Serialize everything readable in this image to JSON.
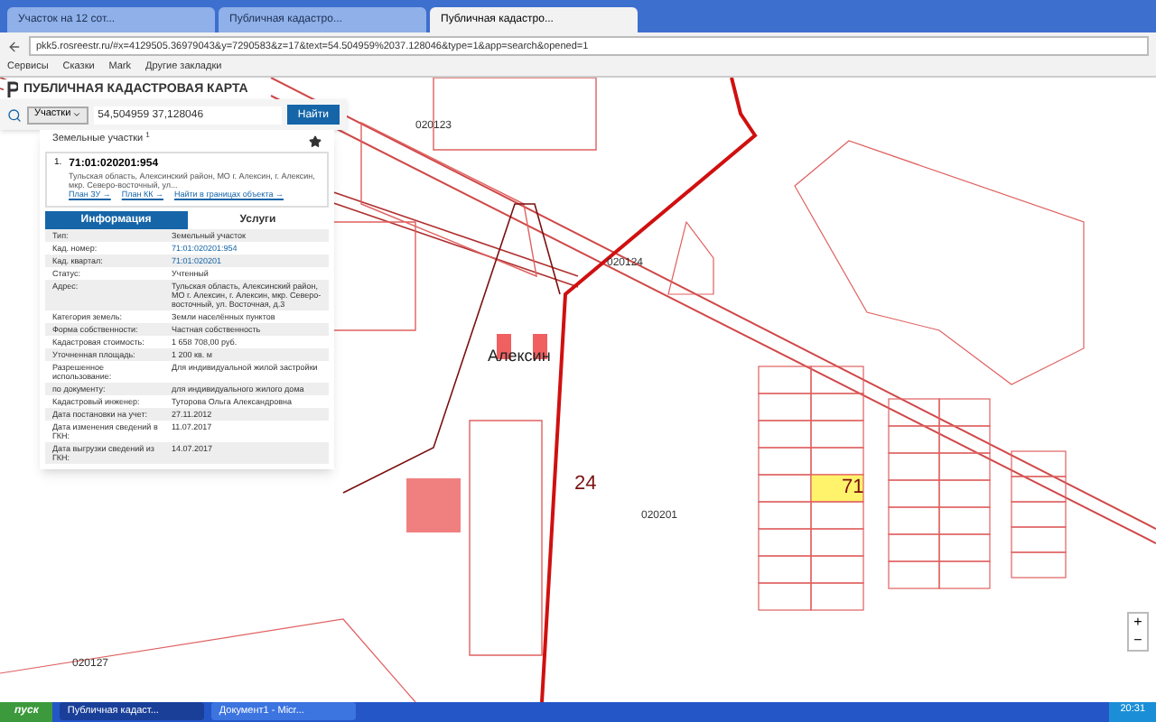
{
  "browser": {
    "tabs": [
      {
        "label": "Участок на 12 сот...",
        "selected": false
      },
      {
        "label": "Публичная кадастро...",
        "selected": false
      },
      {
        "label": "Публичная кадастро...",
        "selected": true
      }
    ],
    "url": "pkk5.rosreestr.ru/#x=4129505.36979043&y=7290583&z=17&text=54.504959%2037.128046&type=1&app=search&opened=1",
    "bookmarks": [
      "Сервисы",
      "Сказки",
      "Mark",
      "Другие закладки"
    ]
  },
  "header": {
    "title": "ПУБЛИЧНАЯ КАДАСТРОВАЯ КАРТА"
  },
  "search": {
    "type": "Участки",
    "value": "54,504959 37,128046",
    "button": "Найти"
  },
  "results": {
    "title": "Земельные участки",
    "count": "1",
    "item": {
      "index": "1.",
      "number": "71:01:020201:954",
      "address": "Тульская область, Алексинский район, МО г. Алексин, г. Алексин, мкр. Северо-восточный, ул...",
      "links": [
        "План ЗУ →",
        "План КК →",
        "Найти в границах объекта →"
      ]
    },
    "tabs": [
      {
        "label": "Информация",
        "selected": true
      },
      {
        "label": "Услуги",
        "selected": false
      }
    ],
    "rows": [
      {
        "label": "Тип:",
        "value": "Земельный участок",
        "link": false
      },
      {
        "label": "Кад. номер:",
        "value": "71:01:020201:954",
        "link": true
      },
      {
        "label": "Кад. квартал:",
        "value": "71:01:020201",
        "link": true
      },
      {
        "label": "Статус:",
        "value": "Учтенный",
        "link": false
      },
      {
        "label": "Адрес:",
        "value": "Тульская область, Алексинский район, МО г. Алексин, г. Алексин, мкр. Северо-восточный, ул. Восточная, д.3",
        "link": false
      },
      {
        "label": "Категория земель:",
        "value": "Земли населённых пунктов",
        "link": false
      },
      {
        "label": "Форма собственности:",
        "value": "Частная собственность",
        "link": false
      },
      {
        "label": "Кадастровая стоимость:",
        "value": "1 658 708,00 руб.",
        "link": false
      },
      {
        "label": "Уточненная площадь:",
        "value": "1 200 кв. м",
        "link": false
      },
      {
        "label": "Разрешенное использование:",
        "value": "Для индивидуальной жилой застройки",
        "link": false
      },
      {
        "label": "по документу:",
        "value": "для индивидуального жилого дома",
        "link": false
      },
      {
        "label": "Кадастровый инженер:",
        "value": "Туторова Ольга Александровна",
        "link": false
      },
      {
        "label": "Дата постановки на учет:",
        "value": "27.11.2012",
        "link": false
      },
      {
        "label": "Дата изменения сведений в ГКН:",
        "value": "11.07.2017",
        "link": false
      },
      {
        "label": "Дата выгрузки сведений из ГКН:",
        "value": "14.07.2017",
        "link": false
      }
    ]
  },
  "map_labels": [
    {
      "text": "020123",
      "kind": "quarter"
    },
    {
      "text": "020124",
      "kind": "quarter"
    },
    {
      "text": "Алексин",
      "kind": "city"
    },
    {
      "text": "24",
      "kind": "region"
    },
    {
      "text": "020201",
      "kind": "quarter"
    },
    {
      "text": "71",
      "kind": "region"
    },
    {
      "text": "020127",
      "kind": "quarter"
    }
  ],
  "zoom": {
    "in": "+",
    "out": "−"
  },
  "taskbar": {
    "start": "пуск",
    "windows": [
      {
        "label": "Публичная кадаст...",
        "selected": true
      },
      {
        "label": "Документ1 - Micr...",
        "selected": false
      }
    ],
    "clock": "20:31"
  }
}
